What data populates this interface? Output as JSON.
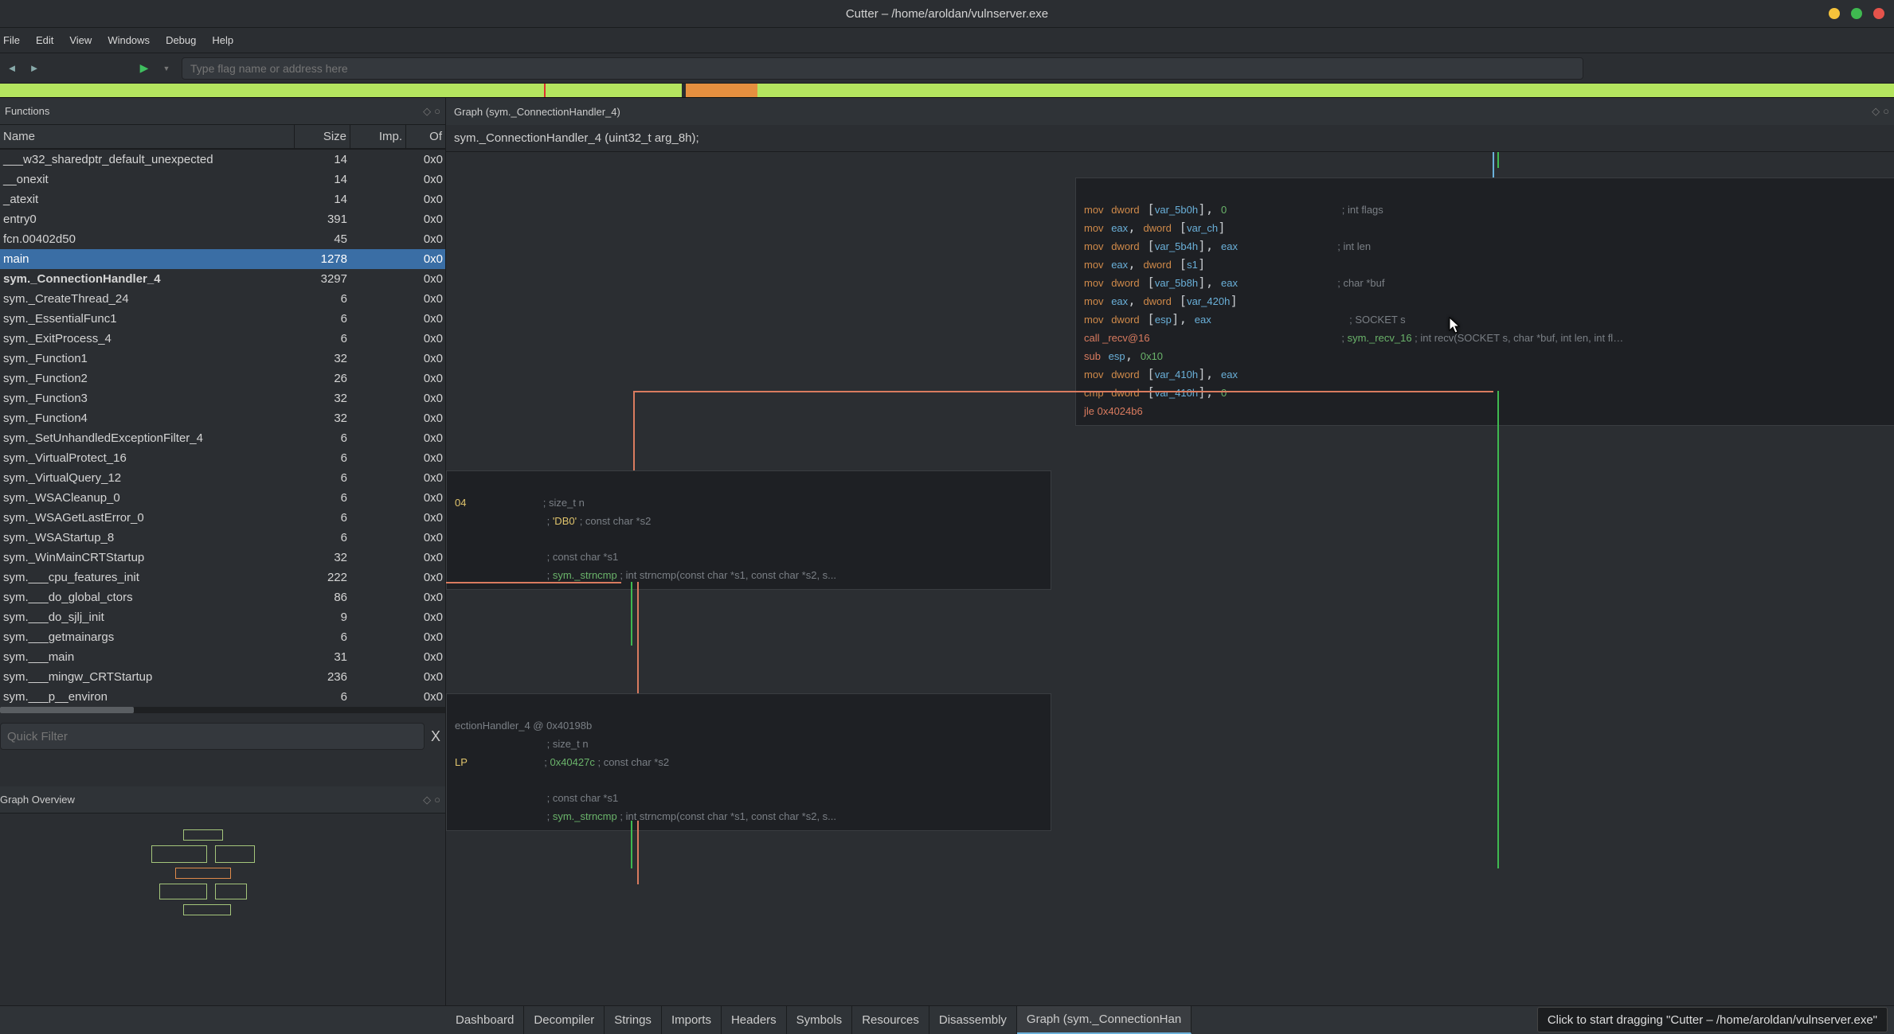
{
  "title": "Cutter – /home/aroldan/vulnserver.exe",
  "menu": [
    "File",
    "Edit",
    "View",
    "Windows",
    "Debug",
    "Help"
  ],
  "addr_placeholder": "Type flag name or address here",
  "side": {
    "title": "Functions",
    "headers": [
      "Name",
      "Size",
      "Imp.",
      "Of"
    ],
    "rows": [
      {
        "n": "___w32_sharedptr_default_unexpected",
        "s": "14",
        "i": "",
        "o": "0x0"
      },
      {
        "n": "__onexit",
        "s": "14",
        "i": "",
        "o": "0x0"
      },
      {
        "n": "_atexit",
        "s": "14",
        "i": "",
        "o": "0x0"
      },
      {
        "n": "entry0",
        "s": "391",
        "i": "",
        "o": "0x0"
      },
      {
        "n": "fcn.00402d50",
        "s": "45",
        "i": "",
        "o": "0x0"
      },
      {
        "n": "main",
        "s": "1278",
        "i": "",
        "o": "0x0",
        "sel": true
      },
      {
        "n": "sym._ConnectionHandler_4",
        "s": "3297",
        "i": "",
        "o": "0x0",
        "bold": true
      },
      {
        "n": "sym._CreateThread_24",
        "s": "6",
        "i": "",
        "o": "0x0"
      },
      {
        "n": "sym._EssentialFunc1",
        "s": "6",
        "i": "",
        "o": "0x0"
      },
      {
        "n": "sym._ExitProcess_4",
        "s": "6",
        "i": "",
        "o": "0x0"
      },
      {
        "n": "sym._Function1",
        "s": "32",
        "i": "",
        "o": "0x0"
      },
      {
        "n": "sym._Function2",
        "s": "26",
        "i": "",
        "o": "0x0"
      },
      {
        "n": "sym._Function3",
        "s": "32",
        "i": "",
        "o": "0x0"
      },
      {
        "n": "sym._Function4",
        "s": "32",
        "i": "",
        "o": "0x0"
      },
      {
        "n": "sym._SetUnhandledExceptionFilter_4",
        "s": "6",
        "i": "",
        "o": "0x0"
      },
      {
        "n": "sym._VirtualProtect_16",
        "s": "6",
        "i": "",
        "o": "0x0"
      },
      {
        "n": "sym._VirtualQuery_12",
        "s": "6",
        "i": "",
        "o": "0x0"
      },
      {
        "n": "sym._WSACleanup_0",
        "s": "6",
        "i": "",
        "o": "0x0"
      },
      {
        "n": "sym._WSAGetLastError_0",
        "s": "6",
        "i": "",
        "o": "0x0"
      },
      {
        "n": "sym._WSAStartup_8",
        "s": "6",
        "i": "",
        "o": "0x0"
      },
      {
        "n": "sym._WinMainCRTStartup",
        "s": "32",
        "i": "",
        "o": "0x0"
      },
      {
        "n": "sym.___cpu_features_init",
        "s": "222",
        "i": "",
        "o": "0x0"
      },
      {
        "n": "sym.___do_global_ctors",
        "s": "86",
        "i": "",
        "o": "0x0"
      },
      {
        "n": "sym.___do_sjlj_init",
        "s": "9",
        "i": "",
        "o": "0x0"
      },
      {
        "n": "sym.___getmainargs",
        "s": "6",
        "i": "",
        "o": "0x0"
      },
      {
        "n": "sym.___main",
        "s": "31",
        "i": "",
        "o": "0x0"
      },
      {
        "n": "sym.___mingw_CRTStartup",
        "s": "236",
        "i": "",
        "o": "0x0"
      },
      {
        "n": "sym.___p__environ",
        "s": "6",
        "i": "",
        "o": "0x0"
      }
    ],
    "qf_placeholder": "Quick Filter",
    "qf_x": "X",
    "overview": "Graph Overview"
  },
  "graph": {
    "title": "Graph (sym._ConnectionHandler_4)",
    "sig": "sym._ConnectionHandler_4 (uint32_t arg_8h);"
  },
  "tabs": [
    "Dashboard",
    "Decompiler",
    "Strings",
    "Imports",
    "Headers",
    "Symbols",
    "Resources",
    "Disassembly",
    "Graph (sym._ConnectionHan"
  ],
  "tooltip": "Click to start dragging \"Cutter – /home/aroldan/vulnserver.exe\""
}
